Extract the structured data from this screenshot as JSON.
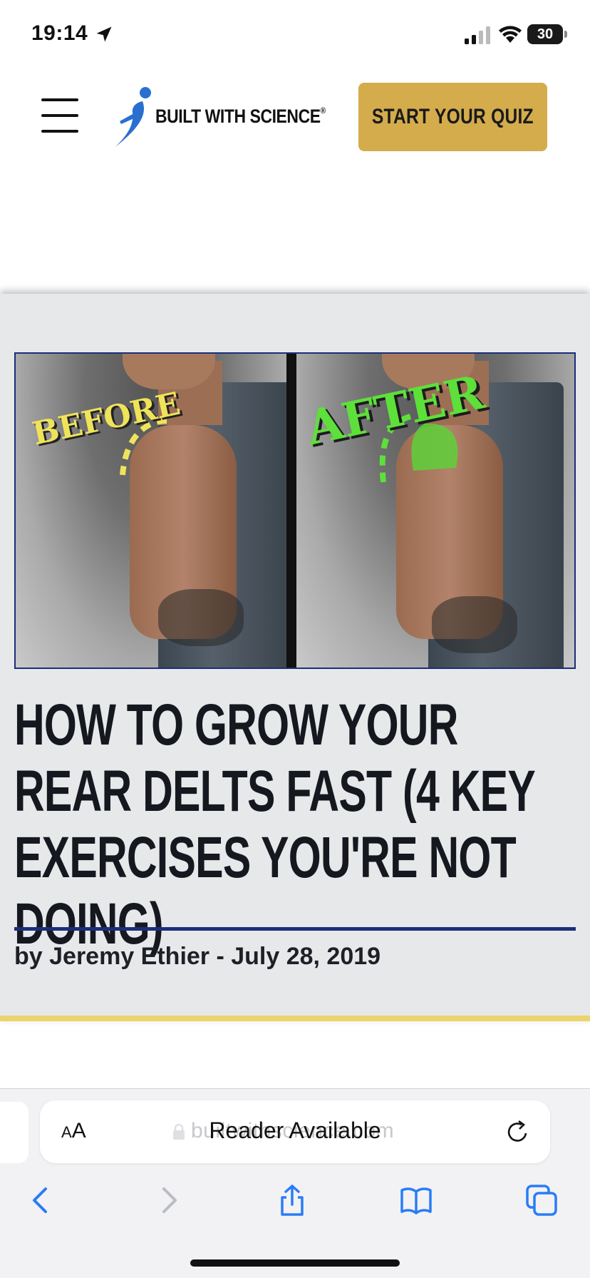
{
  "status_bar": {
    "time": "19:14",
    "battery": "30"
  },
  "header": {
    "logo_text": "BUILT WITH SCIENCE",
    "logo_mark": "®",
    "cta_label": "START YOUR QUIZ"
  },
  "article": {
    "hero": {
      "before_label": "BEFORE",
      "after_label": "AFTER"
    },
    "title": "HOW TO GROW YOUR REAR DELTS FAST (4 KEY EXERCISES YOU'RE NOT DOING)",
    "byline": "by Jeremy Ethier - July 28, 2019"
  },
  "browser": {
    "text_size_label": "AA",
    "url_partial": "builtwithscience.com",
    "reader_label": "Reader Available"
  },
  "colors": {
    "accent_gold": "#d4ac4c",
    "navy": "#1b2e7a",
    "card_bg": "#e7e8ea",
    "bottom_bar": "#ecd46c"
  }
}
